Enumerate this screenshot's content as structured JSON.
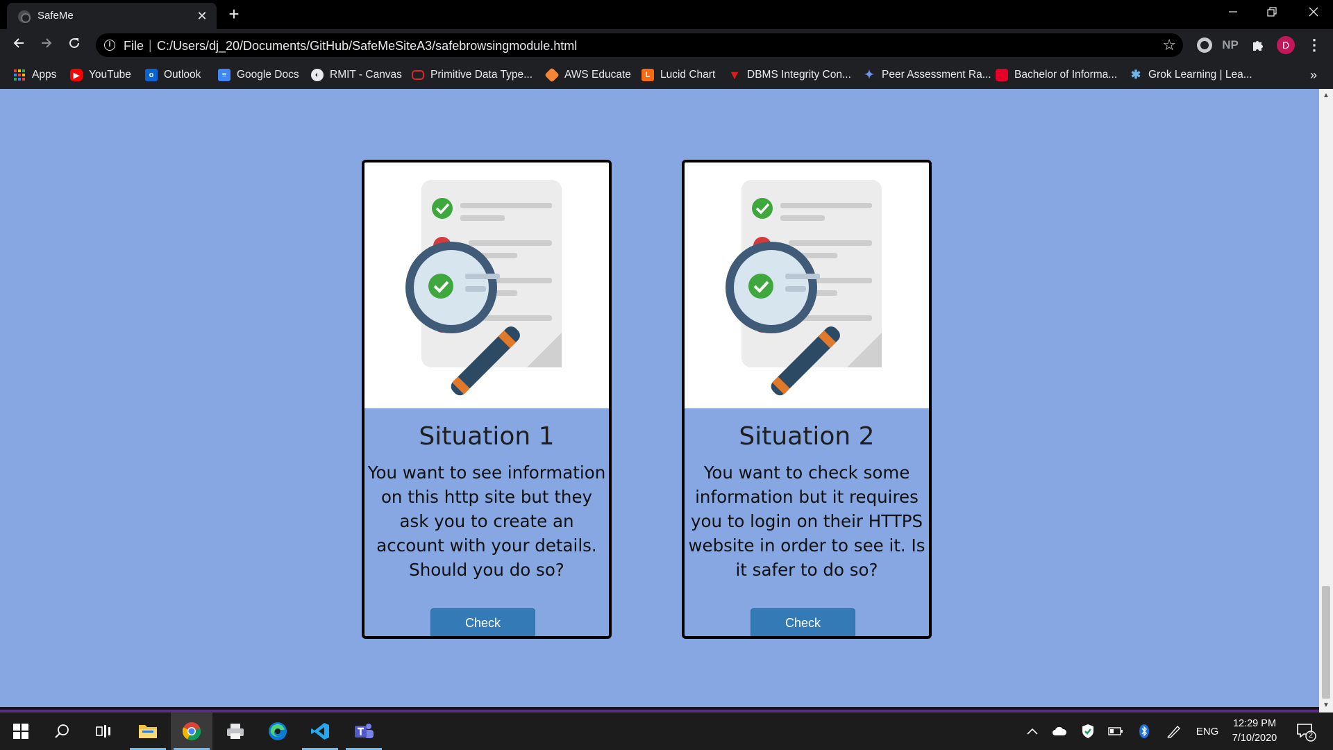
{
  "browser": {
    "tab_title": "SafeMe",
    "new_tab_symbol": "+",
    "close_symbol": "✕",
    "scheme_label": "File",
    "separator": "|",
    "url": "C:/Users/dj_20/Documents/GitHub/SafeMeSiteA3/safebrowsingmodule.html",
    "extension_np_label": "NP",
    "avatar_initial": "D",
    "overflow_symbol": "»"
  },
  "bookmarks": [
    {
      "label": "Apps",
      "icon": "apps-grid-icon",
      "color": "#ea4335"
    },
    {
      "label": "YouTube",
      "icon": "youtube-icon",
      "color": "#ff0000"
    },
    {
      "label": "Outlook",
      "icon": "outlook-icon",
      "color": "#0a64d6"
    },
    {
      "label": "Google Docs",
      "icon": "google-docs-icon",
      "color": "#4285f4"
    },
    {
      "label": "RMIT - Canvas",
      "icon": "globe-icon",
      "color": "#e8eaed"
    },
    {
      "label": "Primitive Data Type...",
      "icon": "oracle-icon",
      "color": "#e0262d"
    },
    {
      "label": "AWS Educate",
      "icon": "aws-educate-icon",
      "color": "#f58536"
    },
    {
      "label": "Lucid Chart",
      "icon": "lucidchart-icon",
      "color": "#f96b13"
    },
    {
      "label": "DBMS Integrity Con...",
      "icon": "dbms-icon",
      "color": "#d91c1c"
    },
    {
      "label": "Peer Assessment Ra...",
      "icon": "peer-assessment-icon",
      "color": "#3a6fd8"
    },
    {
      "label": "Bachelor of Informa...",
      "icon": "rmit-icon",
      "color": "#e60028"
    },
    {
      "label": "Grok Learning | Lea...",
      "icon": "grok-icon",
      "color": "#2f8bd8"
    }
  ],
  "cards": [
    {
      "title": "Situation 1",
      "text": "You want to see information on this http site but they ask you to create an account with your details. Should you do so?",
      "button": "Check Answer!"
    },
    {
      "title": "Situation 2",
      "text": "You want to check some information but it requires you to login on their HTTPS website in order to see it. Is it safer to do so?",
      "button": "Check Answer!"
    }
  ],
  "taskbar": {
    "language": "ENG",
    "time": "12:29 PM",
    "date": "7/10/2020",
    "notification_count": "2"
  },
  "colors": {
    "page_background": "#86a7e2",
    "button_primary": "#337ab7",
    "browser_chrome": "#1f2023",
    "taskbar": "#1c1c1c",
    "avatar": "#c2185b"
  }
}
